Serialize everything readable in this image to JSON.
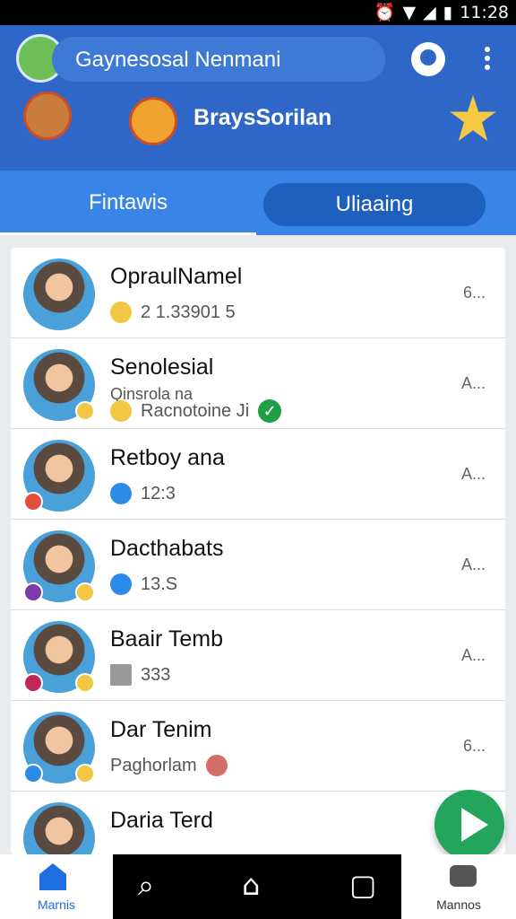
{
  "status": {
    "time": "11:28",
    "icons": [
      "alarm-icon",
      "wifi-icon",
      "signal-icon",
      "battery-icon"
    ]
  },
  "header": {
    "search_text": "Gaynesosal Nenmani",
    "promo_title": "BraysSorilan"
  },
  "tabs": {
    "left": "Fintawis",
    "right": "Uliaaing"
  },
  "contacts": [
    {
      "name": "OpraulNamel",
      "detail": "2 1.33901 5",
      "time": "6..."
    },
    {
      "name": "Senolesial",
      "subline": "Qinsrola na",
      "detail": "Racnotoine Ji",
      "time": "A..."
    },
    {
      "name": "Retboy ana",
      "detail": "12:3",
      "time": "A..."
    },
    {
      "name": "Dacthabats",
      "detail": "13.S",
      "time": "A..."
    },
    {
      "name": "Baair Temb",
      "detail": "333",
      "time": "A..."
    },
    {
      "name": "Dar Tenim",
      "detail": "Paghorlam",
      "time": "6..."
    },
    {
      "name": "Daria Terd",
      "detail": "",
      "time": ""
    }
  ],
  "bottom_nav": {
    "left_label": "Marnis",
    "right_label": "Mannos"
  },
  "colors": {
    "header": "#2f67c8",
    "tab_bar": "#3985e7",
    "fab": "#24a55d",
    "accent": "#1f6fe0"
  }
}
